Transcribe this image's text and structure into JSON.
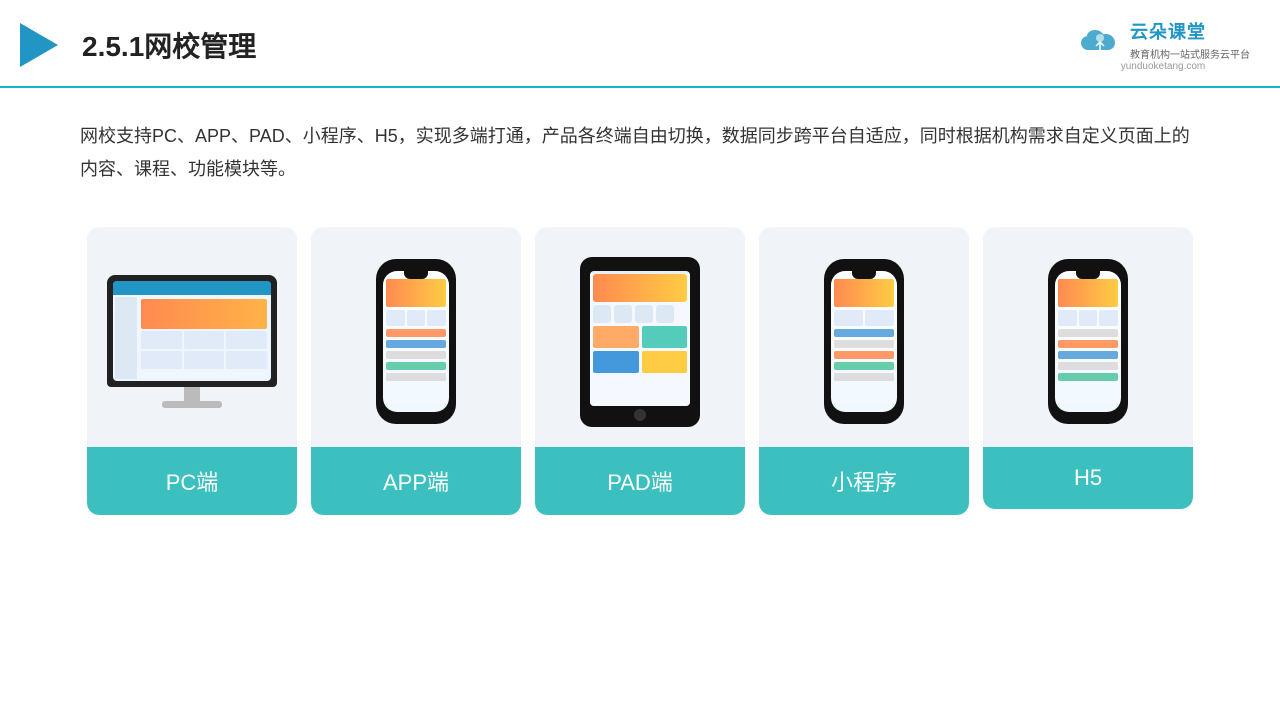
{
  "header": {
    "title": "2.5.1网校管理",
    "logo": {
      "name": "云朵课堂",
      "url": "yunduoketang.com",
      "tagline": "教育机构一站式服务云平台"
    }
  },
  "description": "网校支持PC、APP、PAD、小程序、H5，实现多端打通，产品各终端自由切换，数据同步跨平台自适应，同时根据机构需求自定义页面上的内容、课程、功能模块等。",
  "cards": [
    {
      "label": "PC端",
      "device": "pc"
    },
    {
      "label": "APP端",
      "device": "phone"
    },
    {
      "label": "PAD端",
      "device": "tablet"
    },
    {
      "label": "小程序",
      "device": "phone2"
    },
    {
      "label": "H5",
      "device": "phone3"
    }
  ]
}
